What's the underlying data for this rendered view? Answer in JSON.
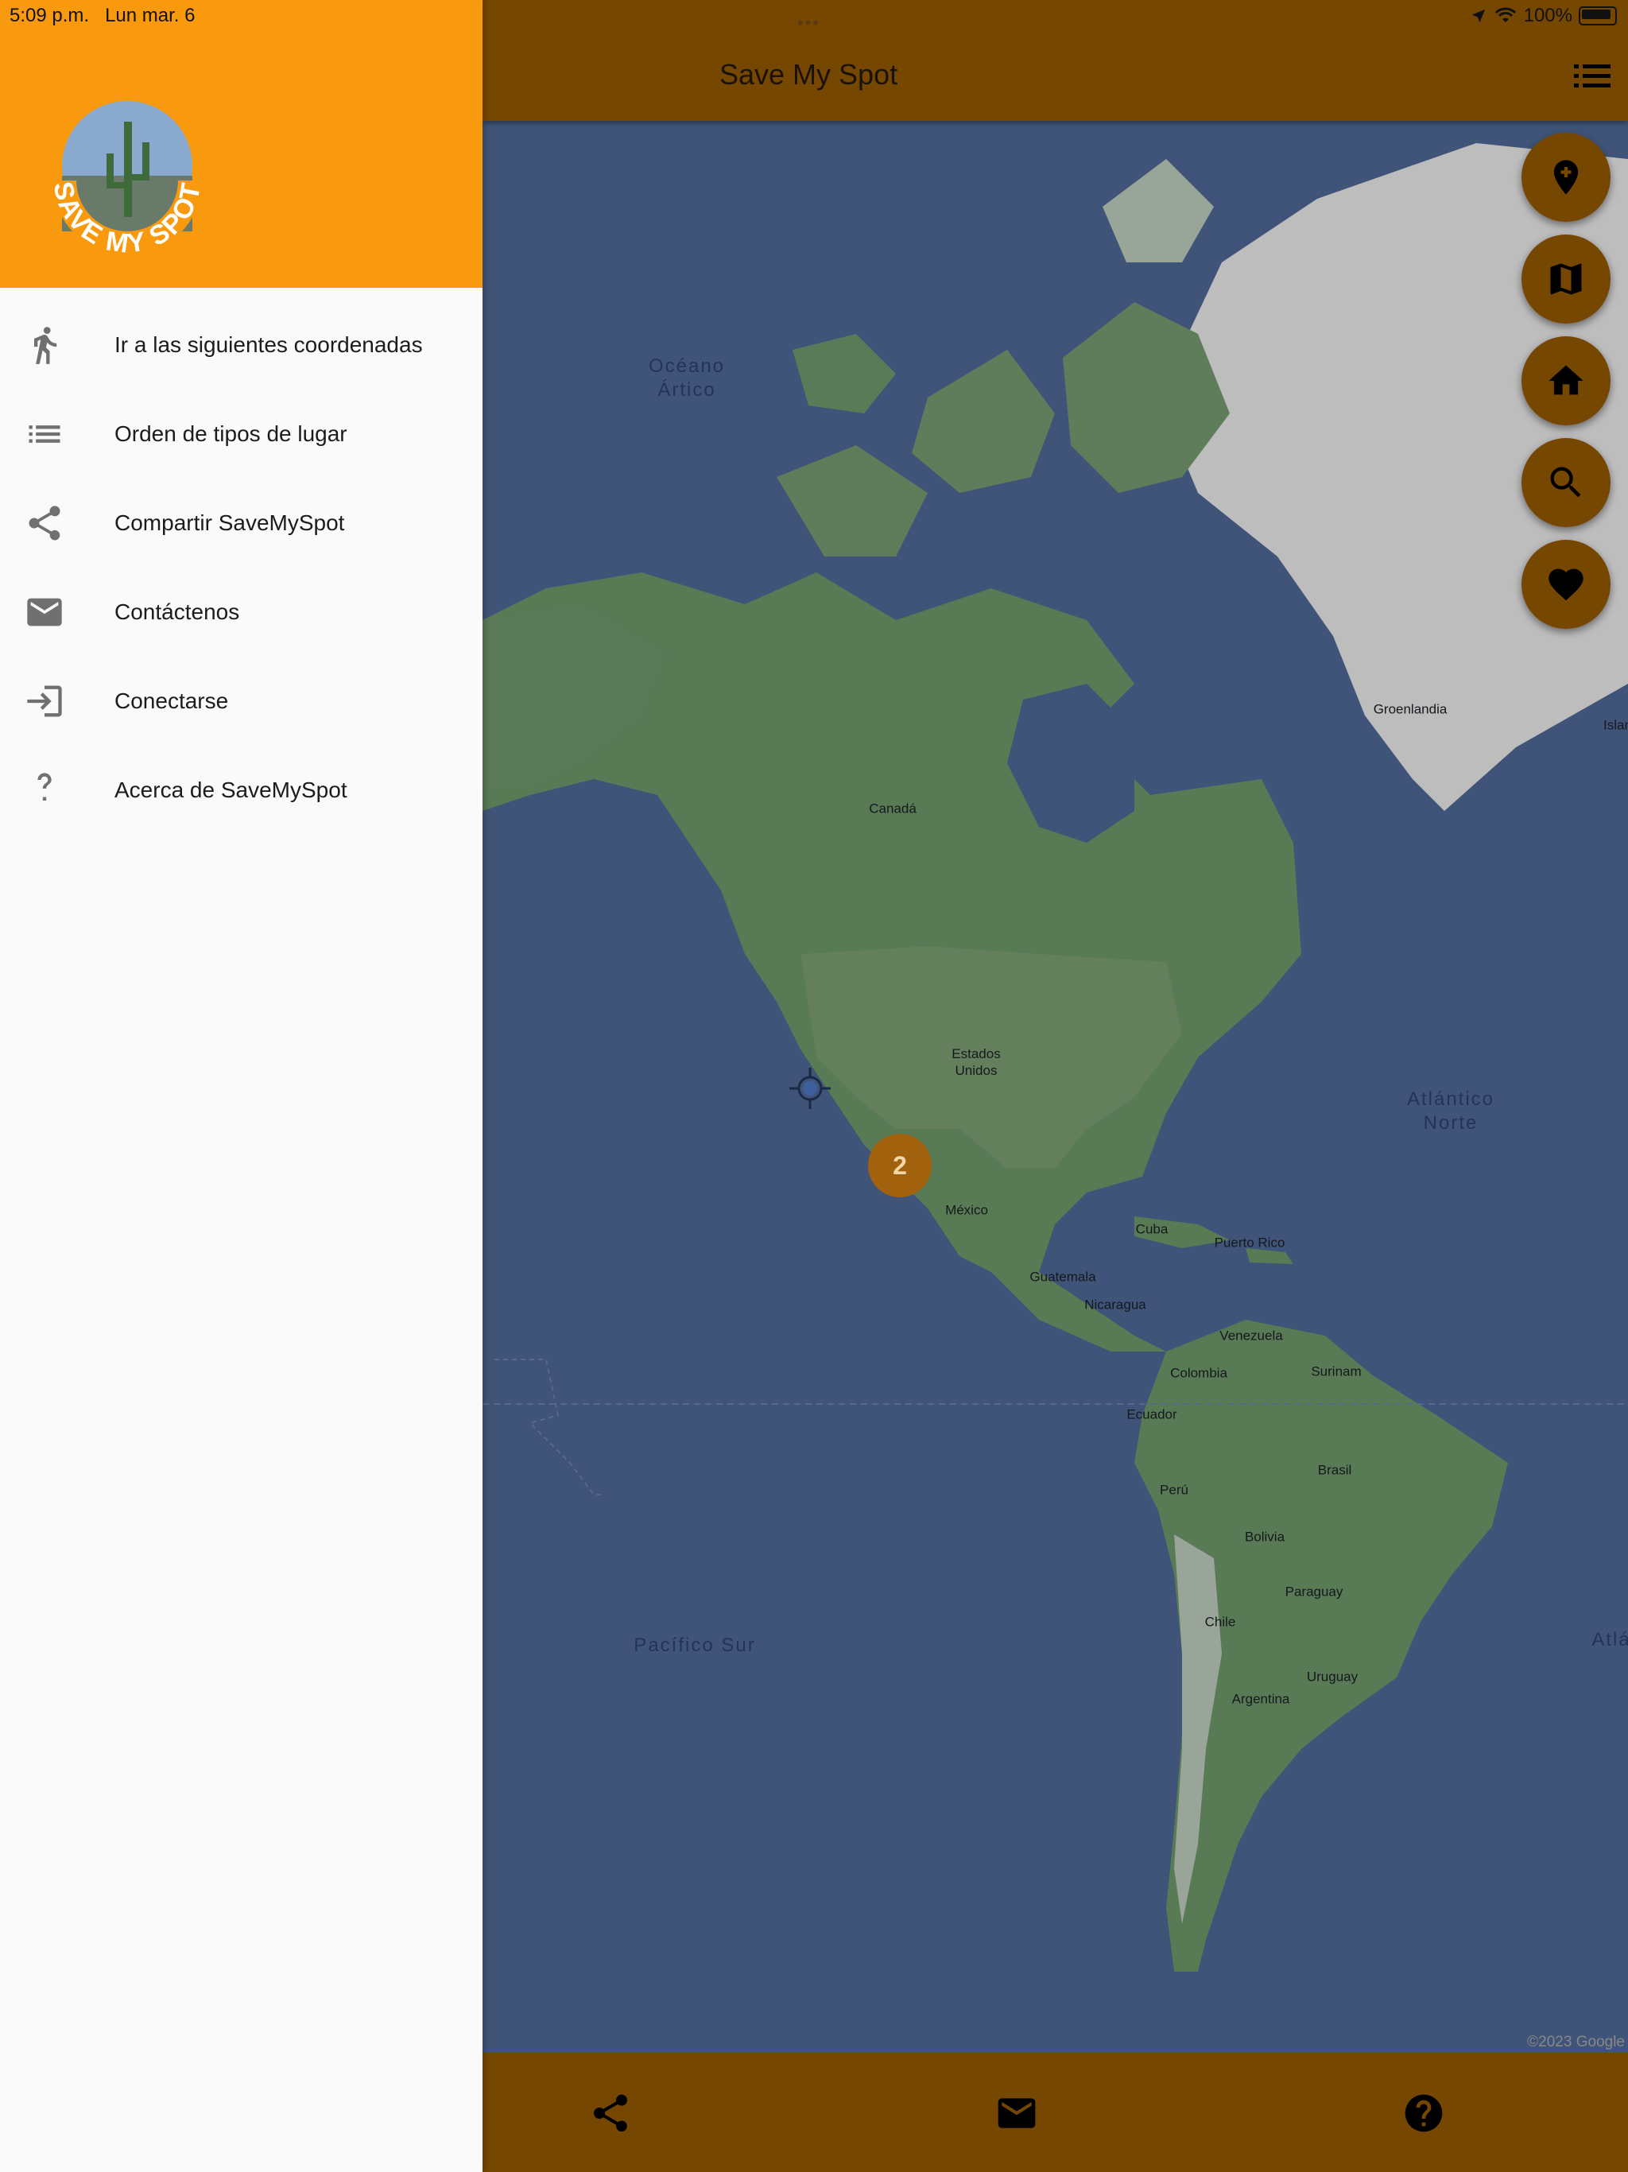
{
  "status_bar": {
    "time": "5:09 p.m.",
    "date": "Lun mar. 6",
    "battery": "100%"
  },
  "app": {
    "title": "Save My Spot",
    "logo_text": "SAVE MY SPOT"
  },
  "drawer": {
    "items": [
      {
        "label": "Ir a las siguientes coordenadas",
        "icon": "walk-icon"
      },
      {
        "label": "Orden de tipos de lugar",
        "icon": "list-icon"
      },
      {
        "label": "Compartir SaveMySpot",
        "icon": "share-icon"
      },
      {
        "label": "Contáctenos",
        "icon": "email-icon"
      },
      {
        "label": "Conectarse",
        "icon": "login-icon"
      },
      {
        "label": "Acerca de SaveMySpot",
        "icon": "help-icon"
      }
    ]
  },
  "fabs": [
    "add-location-icon",
    "map-icon",
    "home-icon",
    "search-icon",
    "heart-icon"
  ],
  "map": {
    "cluster_count": "2",
    "copyright": "©2023 Google",
    "labels": {
      "oceano_artico": "Océano\nÁrtico",
      "groenlandia": "Groenlandia",
      "islandia": "Islan",
      "canada": "Canadá",
      "estados_unidos": "Estados\nUnidos",
      "atlantico_norte": "Atlántico\nNorte",
      "mexico": "México",
      "cuba": "Cuba",
      "puerto_rico": "Puerto Rico",
      "guatemala": "Guatemala",
      "nicaragua": "Nicaragua",
      "venezuela": "Venezuela",
      "colombia": "Colombia",
      "surinam": "Surinam",
      "ecuador": "Ecuador",
      "brasil": "Brasil",
      "peru": "Perú",
      "bolivia": "Bolivia",
      "paraguay": "Paraguay",
      "chile": "Chile",
      "uruguay": "Uruguay",
      "argentina": "Argentina",
      "pacifico_sur": "Pacífico Sur",
      "atlantico_sur": "Atlá"
    }
  },
  "bottom_bar": [
    "share-icon",
    "email-icon",
    "help-icon"
  ]
}
